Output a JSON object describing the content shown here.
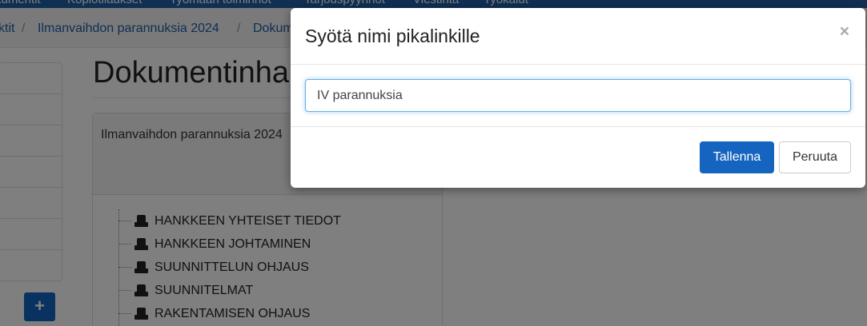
{
  "topnav": {
    "items": [
      "kumentit",
      "Kopiotilaukset",
      "Työmaan toiminnot",
      "Tarjouspyynnöt",
      "Viestintä",
      "Työkalut"
    ]
  },
  "breadcrumb": {
    "items": [
      "ktit",
      "Ilmanvaihdon parannuksia 2024",
      "Dokum"
    ],
    "separator": "/"
  },
  "page": {
    "title": "Dokumentinhallinta",
    "add_button": "+"
  },
  "panel": {
    "heading": "Ilmanvaihdon parannuksia 2024",
    "tree": [
      {
        "label": "HANKKEEN YHTEISET TIEDOT"
      },
      {
        "label": "HANKKEEN JOHTAMINEN"
      },
      {
        "label": "SUUNNITTELUN OHJAUS"
      },
      {
        "label": "SUUNNITELMAT"
      },
      {
        "label": "RAKENTAMISEN OHJAUS"
      }
    ]
  },
  "modal": {
    "title": "Syötä nimi pikalinkille",
    "close": "×",
    "input_value": "IV parannuksia",
    "save_label": "Tallenna",
    "cancel_label": "Peruuta"
  },
  "colors": {
    "primary": "#1565c0",
    "navbar": "#1f5fa6",
    "focus_border": "#66afe9"
  }
}
